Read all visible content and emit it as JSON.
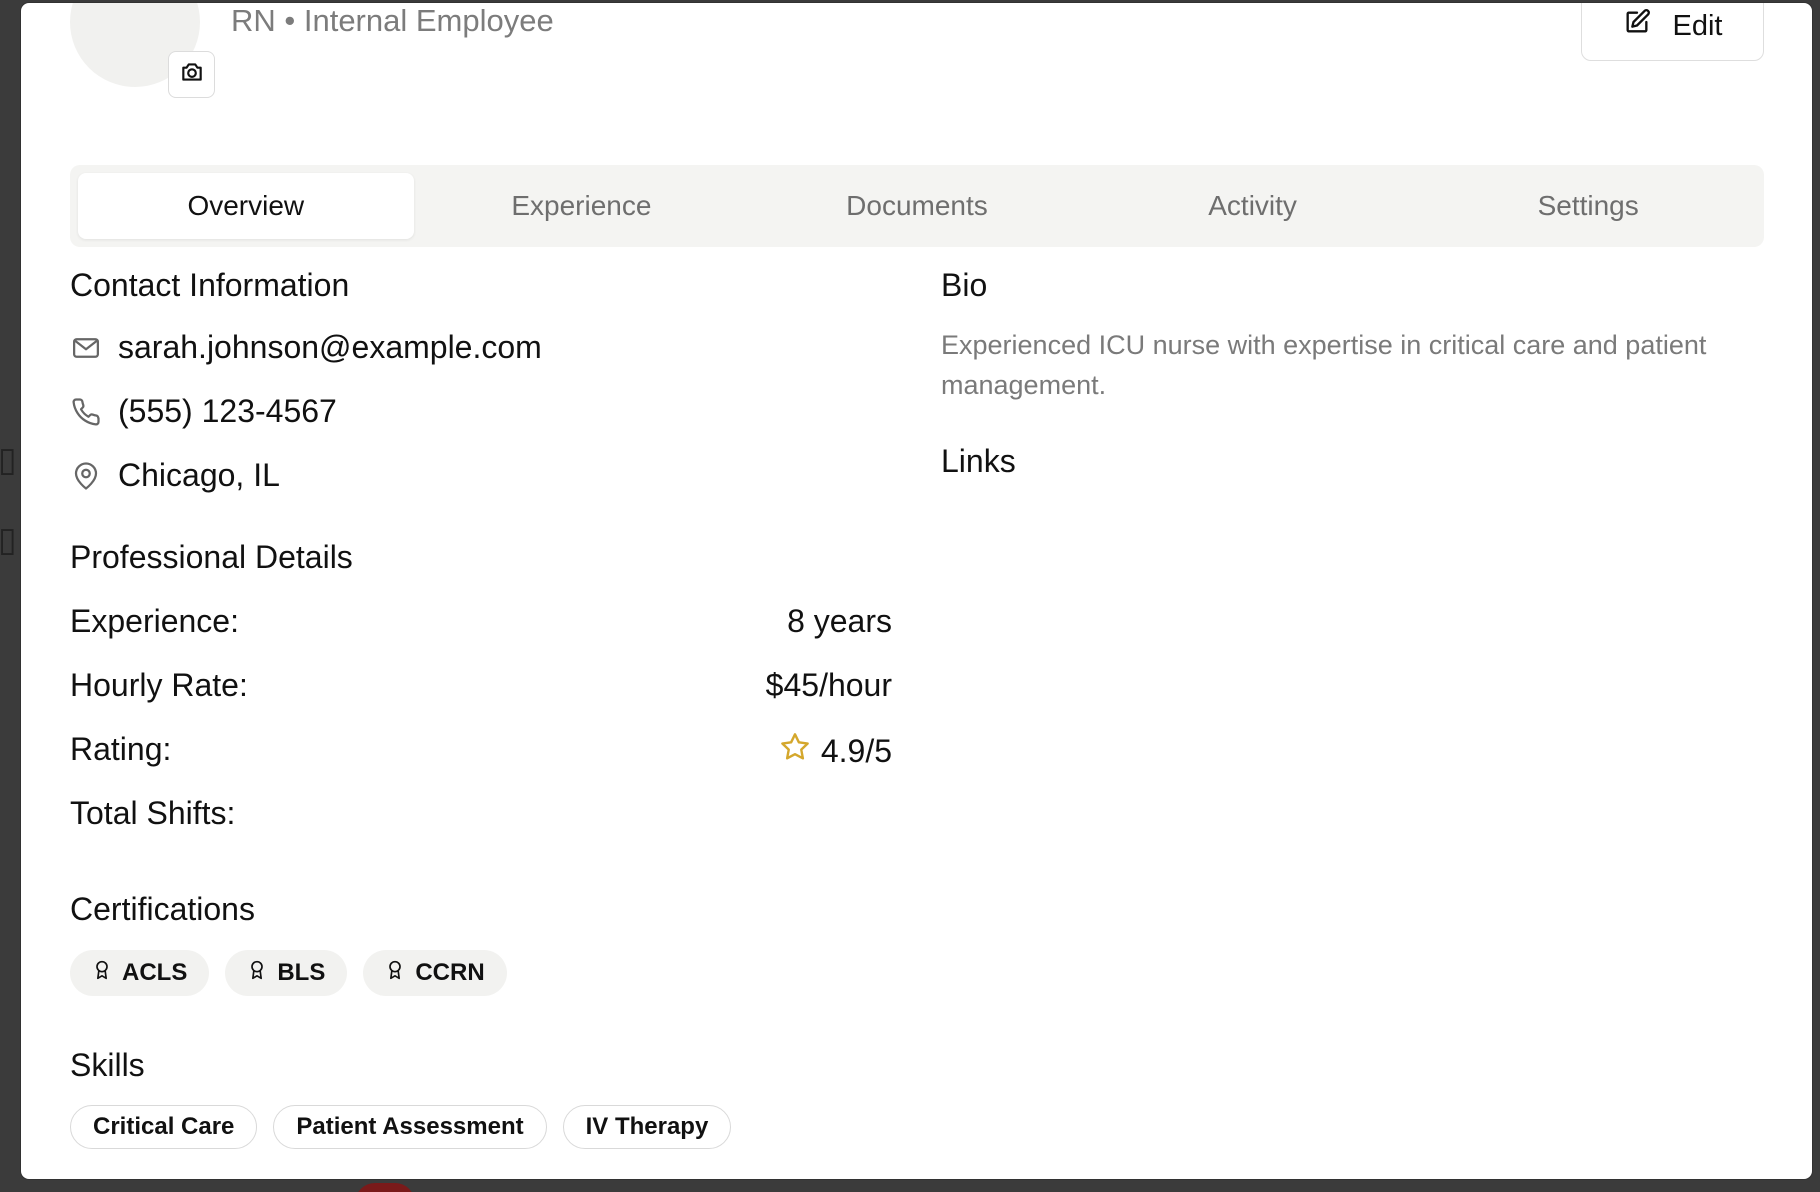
{
  "header": {
    "subtitle": "RN • Internal Employee",
    "edit_label": "Edit"
  },
  "tabs": [
    {
      "label": "Overview",
      "active": true
    },
    {
      "label": "Experience",
      "active": false
    },
    {
      "label": "Documents",
      "active": false
    },
    {
      "label": "Activity",
      "active": false
    },
    {
      "label": "Settings",
      "active": false
    }
  ],
  "contact": {
    "title": "Contact Information",
    "email": "sarah.johnson@example.com",
    "phone": "(555) 123-4567",
    "location": "Chicago, IL"
  },
  "professional": {
    "title": "Professional Details",
    "experience_label": "Experience:",
    "experience_value": "8 years",
    "rate_label": "Hourly Rate:",
    "rate_value": "$45/hour",
    "rating_label": "Rating:",
    "rating_value": "4.9/5",
    "shifts_label": "Total Shifts:"
  },
  "certifications": {
    "title": "Certifications",
    "items": [
      "ACLS",
      "BLS",
      "CCRN"
    ]
  },
  "skills": {
    "title": "Skills",
    "items": [
      "Critical Care",
      "Patient Assessment",
      "IV Therapy"
    ]
  },
  "bio": {
    "title": "Bio",
    "text": "Experienced ICU nurse with expertise in critical care and patient management."
  },
  "links": {
    "title": "Links"
  },
  "icons": {
    "camera": "camera-icon",
    "edit": "edit-icon",
    "email": "mail-icon",
    "phone": "phone-icon",
    "location": "map-pin-icon",
    "rating": "star-icon",
    "certification": "award-icon"
  },
  "colors": {
    "star": "#d4a72c",
    "muted_text": "#7a7a7a",
    "tab_bg": "#f4f4f2"
  }
}
